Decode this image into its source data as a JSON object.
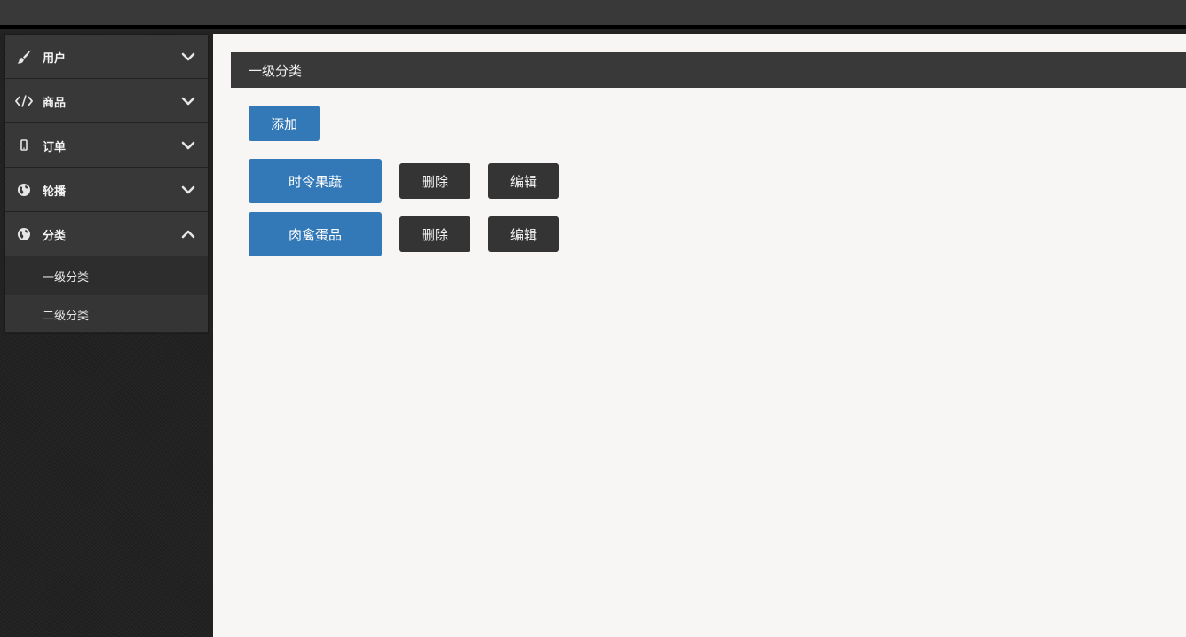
{
  "sidebar": {
    "items": [
      {
        "label": "用户",
        "icon": "brush-icon",
        "expanded": false
      },
      {
        "label": "商品",
        "icon": "code-icon",
        "expanded": false
      },
      {
        "label": "订单",
        "icon": "mobile-icon",
        "expanded": false
      },
      {
        "label": "轮播",
        "icon": "globe-icon",
        "expanded": false
      },
      {
        "label": "分类",
        "icon": "globe-icon",
        "expanded": true
      }
    ],
    "subitems": [
      {
        "label": "一级分类",
        "selected": true
      },
      {
        "label": "二级分类",
        "selected": false
      }
    ]
  },
  "main": {
    "header_title": "一级分类",
    "add_label": "添加",
    "categories": [
      {
        "name": "时令果蔬",
        "delete_label": "删除",
        "edit_label": "编辑"
      },
      {
        "name": "肉禽蛋品",
        "delete_label": "删除",
        "edit_label": "编辑"
      }
    ]
  },
  "colors": {
    "primary": "#3479b7",
    "dark": "#343434",
    "header": "#393939",
    "content_bg": "#f7f6f4"
  }
}
